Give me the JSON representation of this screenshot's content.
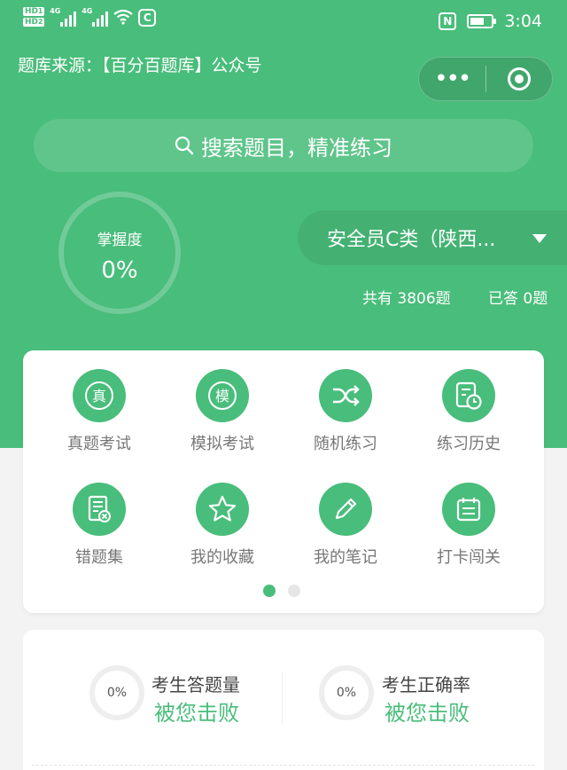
{
  "status_bar": {
    "hd1": "HD",
    "hd1_sub": "1",
    "hd2": "HD",
    "hd2_sub": "2",
    "net1": "4G",
    "net2": "4G",
    "app_badge": "C",
    "nfc": "N",
    "time": "3:04"
  },
  "header": {
    "source_text": "题库来源：【百分百题库】公众号",
    "capsule_more": "•••"
  },
  "search": {
    "placeholder": "搜索题目，精准练习"
  },
  "mastery": {
    "label": "掌握度",
    "value": "0%"
  },
  "question_bank": {
    "selected": "安全员C类（陕西...",
    "total_label": "共有 3806题",
    "answered_label": "已答 0题"
  },
  "menu": {
    "items": [
      {
        "label": "真题考试",
        "icon": "zhen-icon"
      },
      {
        "label": "模拟考试",
        "icon": "mo-icon"
      },
      {
        "label": "随机练习",
        "icon": "shuffle-icon"
      },
      {
        "label": "练习历史",
        "icon": "history-icon"
      },
      {
        "label": "错题集",
        "icon": "wrong-book-icon"
      },
      {
        "label": "我的收藏",
        "icon": "star-icon"
      },
      {
        "label": "我的笔记",
        "icon": "pencil-icon"
      },
      {
        "label": "打卡闯关",
        "icon": "calendar-icon"
      }
    ],
    "page_index": 1,
    "page_count": 2
  },
  "stats": {
    "answer_count": {
      "percent": "0%",
      "title": "考生答题量",
      "subtitle": "被您击败"
    },
    "accuracy": {
      "percent": "0%",
      "title": "考生正确率",
      "subtitle": "被您击败"
    }
  },
  "colors": {
    "brand_green": "#49bd7b",
    "page_bg": "#f3f3f3"
  }
}
